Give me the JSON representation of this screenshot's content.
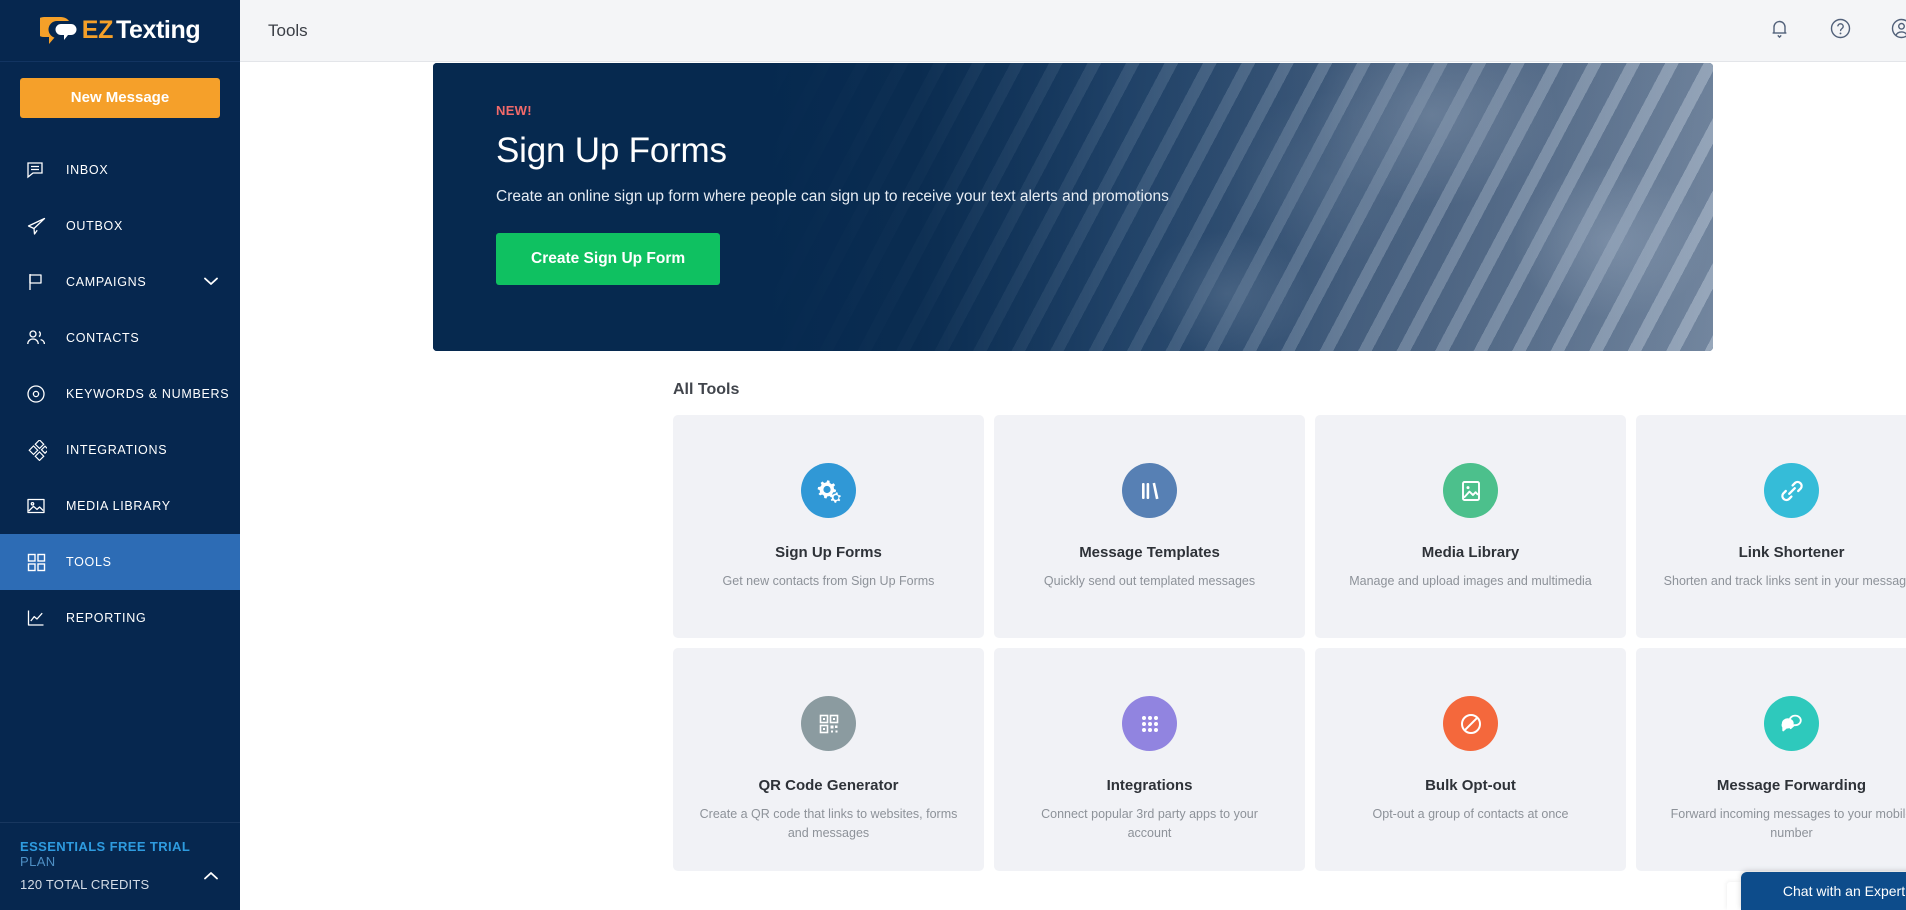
{
  "brand": {
    "logo_ez": "EZ",
    "logo_texting": "Texting",
    "logo_icon": "speech-bubble-logo-icon"
  },
  "sidebar": {
    "new_message_label": "New Message",
    "items": [
      {
        "label": "INBOX",
        "icon": "inbox-chat-icon",
        "active": false,
        "caret": false
      },
      {
        "label": "OUTBOX",
        "icon": "paper-plane-icon",
        "active": false,
        "caret": false
      },
      {
        "label": "CAMPAIGNS",
        "icon": "flag-icon",
        "active": false,
        "caret": true
      },
      {
        "label": "CONTACTS",
        "icon": "people-icon",
        "active": false,
        "caret": false
      },
      {
        "label": "KEYWORDS & NUMBERS",
        "icon": "target-circle-icon",
        "active": false,
        "caret": false
      },
      {
        "label": "INTEGRATIONS",
        "icon": "diamonds-icon",
        "active": false,
        "caret": false
      },
      {
        "label": "MEDIA LIBRARY",
        "icon": "image-icon",
        "active": false,
        "caret": false
      },
      {
        "label": "TOOLS",
        "icon": "grid-squares-icon",
        "active": true,
        "caret": false
      },
      {
        "label": "REPORTING",
        "icon": "line-chart-icon",
        "active": false,
        "caret": false
      }
    ],
    "plan": {
      "name": "ESSENTIALS FREE TRIAL",
      "suffix": "PLAN",
      "credits": "120 TOTAL CREDITS",
      "collapse_icon": "chevron-up-icon"
    }
  },
  "header": {
    "title": "Tools",
    "icons": [
      {
        "name": "notifications-bell-icon"
      },
      {
        "name": "help-circle-icon"
      },
      {
        "name": "account-circle-icon"
      }
    ]
  },
  "hero": {
    "badge": "NEW!",
    "title": "Sign Up Forms",
    "subtitle": "Create an online sign up form where people can sign up to receive your text alerts and promotions",
    "cta_label": "Create Sign Up Form",
    "cta_color": "#0fc161",
    "badge_color": "#f26a6a",
    "background_color": "#06294f"
  },
  "tools_section": {
    "title": "All Tools",
    "cards": [
      {
        "title": "Sign Up Forms",
        "desc": "Get new contacts from Sign Up Forms",
        "icon": "gears-icon",
        "color": "#3098d6"
      },
      {
        "title": "Message Templates",
        "desc": "Quickly send out templated messages",
        "icon": "books-icon",
        "color": "#5780b4"
      },
      {
        "title": "Media Library",
        "desc": "Manage and upload images and multimedia",
        "icon": "image-icon",
        "color": "#4cc08c"
      },
      {
        "title": "Link Shortener",
        "desc": "Shorten and track links sent in your messages",
        "icon": "link-chain-icon",
        "color": "#35bcd8"
      },
      {
        "title": "QR Code Generator",
        "desc": "Create a QR code that links to websites, forms and messages",
        "icon": "qr-code-icon",
        "color": "#8b9ba0"
      },
      {
        "title": "Integrations",
        "desc": "Connect popular 3rd party apps to your account",
        "icon": "dot-grid-icon",
        "color": "#9184e0"
      },
      {
        "title": "Bulk Opt-out",
        "desc": "Opt-out a group of contacts at once",
        "icon": "no-entry-icon",
        "color": "#f4683c"
      },
      {
        "title": "Message Forwarding",
        "desc": "Forward incoming messages to your mobile number",
        "icon": "chat-bubbles-icon",
        "color": "#2ec9bc"
      }
    ]
  },
  "chat_widget": {
    "label": "Chat with an Expert",
    "color": "#0d4c8b"
  }
}
